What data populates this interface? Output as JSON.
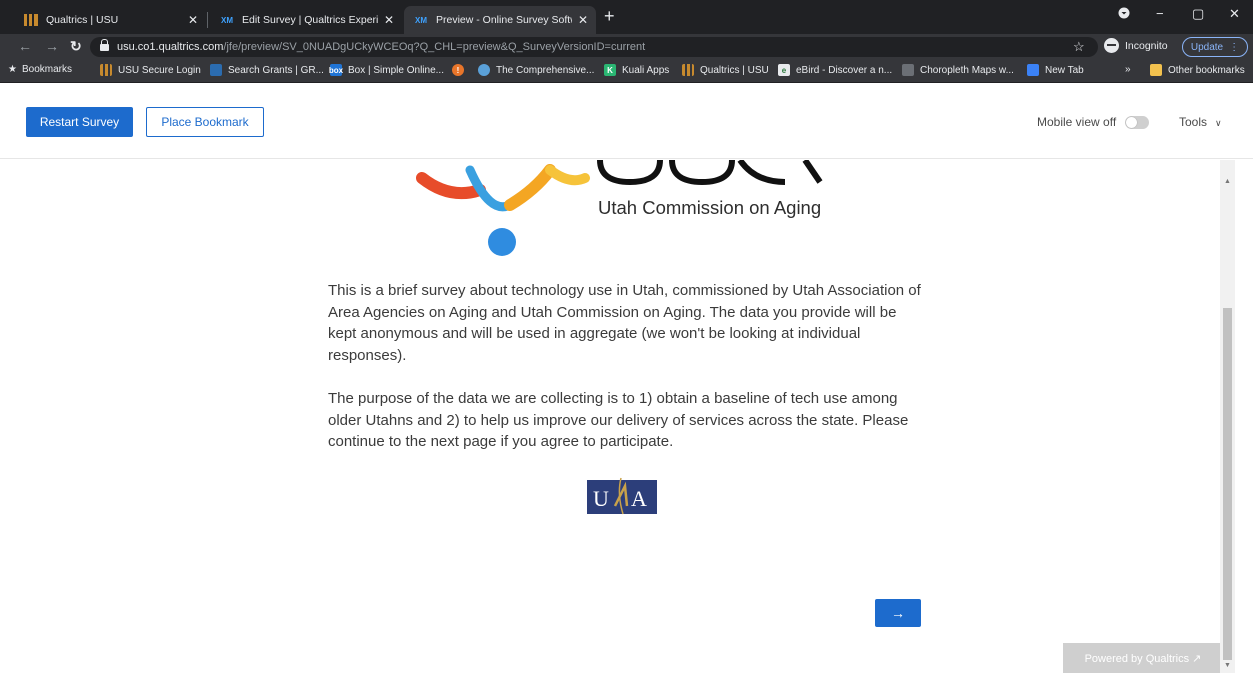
{
  "browser": {
    "tabs": [
      {
        "title": "Qualtrics | USU",
        "active": false
      },
      {
        "title": "Edit Survey | Qualtrics Experience",
        "active": false
      },
      {
        "title": "Preview - Online Survey Software",
        "active": true
      }
    ],
    "url_host": "usu.co1.qualtrics.com",
    "url_path": "/jfe/preview/SV_0NUADgUCkyWCEOq?Q_CHL=preview&Q_SurveyVersionID=current",
    "incognito_label": "Incognito",
    "update_label": "Update",
    "bookmarks": [
      "Bookmarks",
      "USU Secure Login",
      "Search Grants | GR...",
      "Box | Simple Online...",
      "The Comprehensive...",
      "Kuali Apps",
      "Qualtrics | USU",
      "eBird - Discover a n...",
      "Choropleth Maps w...",
      "New Tab"
    ],
    "other_bookmarks": "Other bookmarks",
    "overflow": "»"
  },
  "preview_header": {
    "restart_label": "Restart Survey",
    "bookmark_label": "Place Bookmark",
    "mobile_view_label": "Mobile view off",
    "mobile_view_on": false,
    "tools_label": "Tools"
  },
  "survey": {
    "logo_caption": "Utah Commission on Aging",
    "paragraph_1": "This is a brief survey about technology use in Utah, commissioned by Utah Association of Area Agencies on Aging and Utah Commission on Aging. The data you provide will be kept anonymous and will be used in aggregate (we won't be looking at individual responses).",
    "paragraph_2": "The purpose of the data we are collecting is to 1) obtain a baseline of tech use among older Utahns and 2) to help us improve our delivery of services across the state. Please continue to the next page if you agree to participate.",
    "next_label": "→",
    "powered_by": "Powered by Qualtrics ↗"
  },
  "colors": {
    "accent": "#1d6bcd",
    "chrome_dark": "#202124",
    "chrome_mid": "#35363a"
  }
}
